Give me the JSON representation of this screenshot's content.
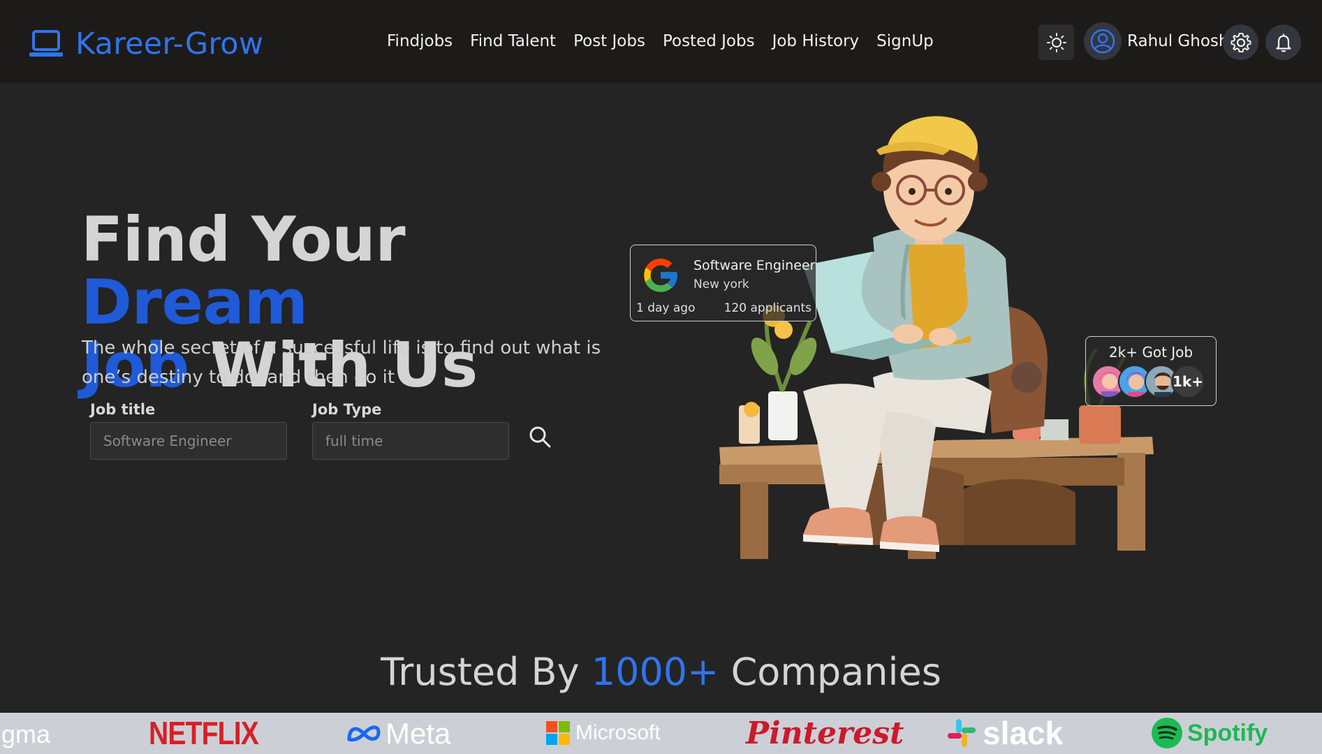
{
  "brand": {
    "name": "Kareer-Grow",
    "icon": "laptop-icon",
    "color": "#2f74ee"
  },
  "nav": [
    "Findjobs",
    "Find Talent",
    "Post Jobs",
    "Posted Jobs",
    "Job History",
    "SignUp"
  ],
  "header_actions": {
    "theme_icon": "sun-icon",
    "user_icon": "user-circle-icon",
    "user_name": "Rahul Ghosh",
    "settings_icon": "gear-icon",
    "notification_icon": "bell-icon"
  },
  "hero": {
    "headline_part1": "Find Your ",
    "headline_highlight1": "Dream",
    "headline_highlight2": "Job",
    "headline_part2": " With Us",
    "subtitle": "The whole secret of a successful life is to find out what is one’s destiny to do, and then do it",
    "accent_color": "#1f5ad8"
  },
  "search": {
    "job_title_label": "Job title",
    "job_title_placeholder": "Software Engineer",
    "job_type_label": "Job Type",
    "job_type_placeholder": "full time",
    "search_icon": "search-icon"
  },
  "job_card": {
    "company_icon": "google-logo",
    "title": "Software Engineer",
    "location": "New york",
    "posted": "1 day ago",
    "applicants": "120 applicants"
  },
  "got_job_card": {
    "title": "2k+ Got Job",
    "count": "1k+"
  },
  "trusted": {
    "prefix": "Trusted By ",
    "count": "1000+",
    "suffix": " Companies"
  },
  "companies": [
    "gma",
    "NETFLIX",
    "Meta",
    "Microsoft",
    "Pinterest",
    "slack",
    "Spotify"
  ]
}
